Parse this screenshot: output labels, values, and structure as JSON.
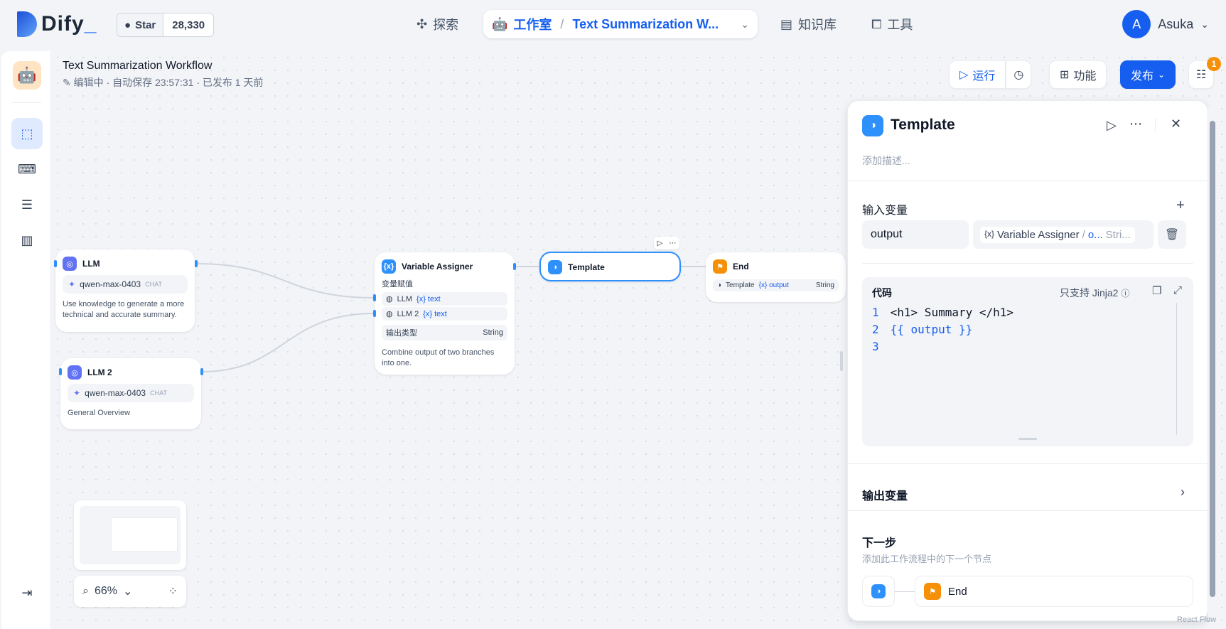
{
  "brand": {
    "name": "Dify",
    "accent": "#155eef"
  },
  "github": {
    "star_label": "Star",
    "count": "28,330"
  },
  "nav": {
    "explore": "探索",
    "studio": "工作室",
    "app_name": "Text Summarization W...",
    "knowledge": "知识库",
    "tools": "工具"
  },
  "user": {
    "initial": "A",
    "name": "Asuka"
  },
  "workflow": {
    "title": "Text Summarization Workflow",
    "status": "编辑中 · 自动保存 23:57:31 · 已发布 1 天前"
  },
  "toolbar": {
    "run": "运行",
    "features": "功能",
    "publish": "发布",
    "badge": "1"
  },
  "nodes": {
    "llm": {
      "title": "LLM",
      "model": "qwen-max-0403",
      "mode": "CHAT",
      "desc": "Use knowledge to generate a more technical and accurate summary."
    },
    "llm2": {
      "title": "LLM 2",
      "model": "qwen-max-0403",
      "mode": "CHAT",
      "desc": "General Overview"
    },
    "assigner": {
      "title": "Variable Assigner",
      "section": "变量赋值",
      "row1_src": "LLM",
      "row1_var": "{x} text",
      "row2_src": "LLM 2",
      "row2_var": "{x} text",
      "out_type_label": "输出类型",
      "out_type": "String",
      "desc": "Combine output of two branches into one."
    },
    "template": {
      "title": "Template"
    },
    "end": {
      "title": "End",
      "src": "Template",
      "var": "{x} output",
      "type": "String"
    }
  },
  "zoom": {
    "level": "66%"
  },
  "panel": {
    "title": "Template",
    "desc_placeholder": "添加描述...",
    "input_vars_label": "输入变量",
    "var_name": "output",
    "var_source": "Variable Assigner",
    "var_source_short": "o...",
    "var_type": "Stri...",
    "code_label": "代码",
    "code_hint": "只支持 Jinja2",
    "code_lines": [
      {
        "n": "1",
        "text": "<h1> Summary </h1>"
      },
      {
        "n": "2",
        "text": "{{ output }}"
      },
      {
        "n": "3",
        "text": ""
      }
    ],
    "output_vars_label": "输出变量",
    "next_label": "下一步",
    "next_desc": "添加此工作流程中的下一个节点",
    "next_node": "End"
  },
  "watermark": "React Flow"
}
